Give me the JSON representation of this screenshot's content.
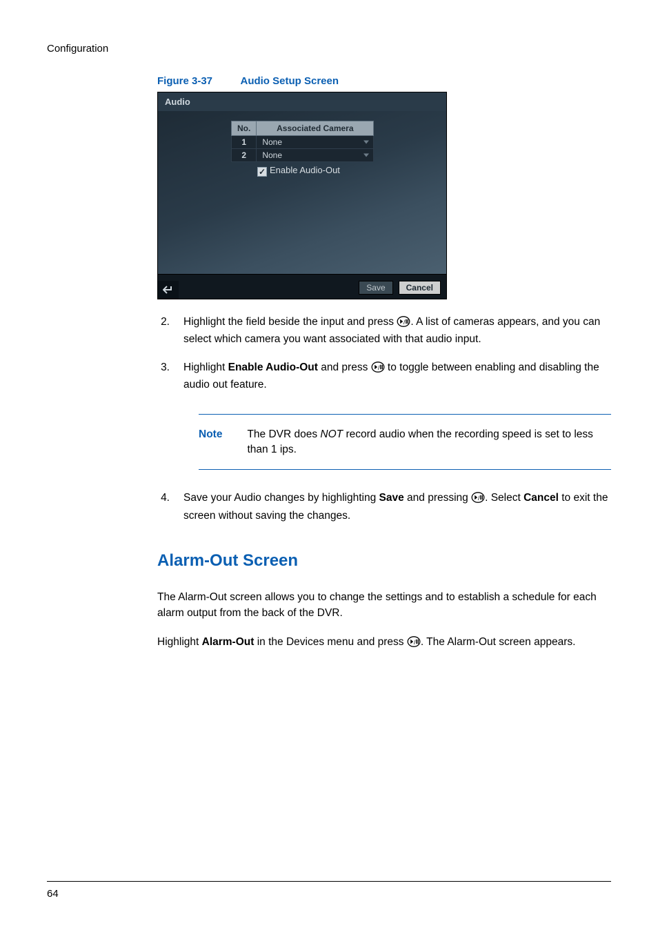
{
  "running_head": "Configuration",
  "figure": {
    "label": "Figure 3-37",
    "title": "Audio Setup Screen"
  },
  "screenshot": {
    "title": "Audio",
    "table": {
      "headers": {
        "no": "No.",
        "assoc": "Associated Camera"
      },
      "rows": [
        {
          "no": "1",
          "value": "None"
        },
        {
          "no": "2",
          "value": "None"
        }
      ]
    },
    "checkbox_label": "Enable Audio-Out",
    "buttons": {
      "save": "Save",
      "cancel": "Cancel"
    }
  },
  "steps": {
    "s2_num": "2.",
    "s2_a": "Highlight the field beside the input and press ",
    "s2_b": ". A list of cameras appears, and you can select which camera you want associated with that audio input.",
    "s3_num": "3.",
    "s3_a": "Highlight ",
    "s3_bold": "Enable Audio-Out",
    "s3_b": " and press ",
    "s3_c": " to toggle between enabling and disabling the audio out feature.",
    "s4_num": "4.",
    "s4_a": "Save your Audio changes by highlighting ",
    "s4_bold1": "Save",
    "s4_b": " and pressing ",
    "s4_c": ". Select ",
    "s4_bold2": "Cancel",
    "s4_d": " to exit the screen without saving the changes."
  },
  "note": {
    "label": "Note",
    "text_a": "The DVR does ",
    "text_em": "NOT",
    "text_b": " record audio when the recording speed is set to less than 1 ips."
  },
  "section_heading": "Alarm-Out Screen",
  "para1": "The Alarm-Out screen allows you to change the settings and to establish a schedule for each alarm output from the back of the DVR.",
  "para2_a": "Highlight ",
  "para2_bold": "Alarm-Out",
  "para2_b": " in the Devices menu and press ",
  "para2_c": ". The Alarm-Out screen appears.",
  "page_number": "64"
}
